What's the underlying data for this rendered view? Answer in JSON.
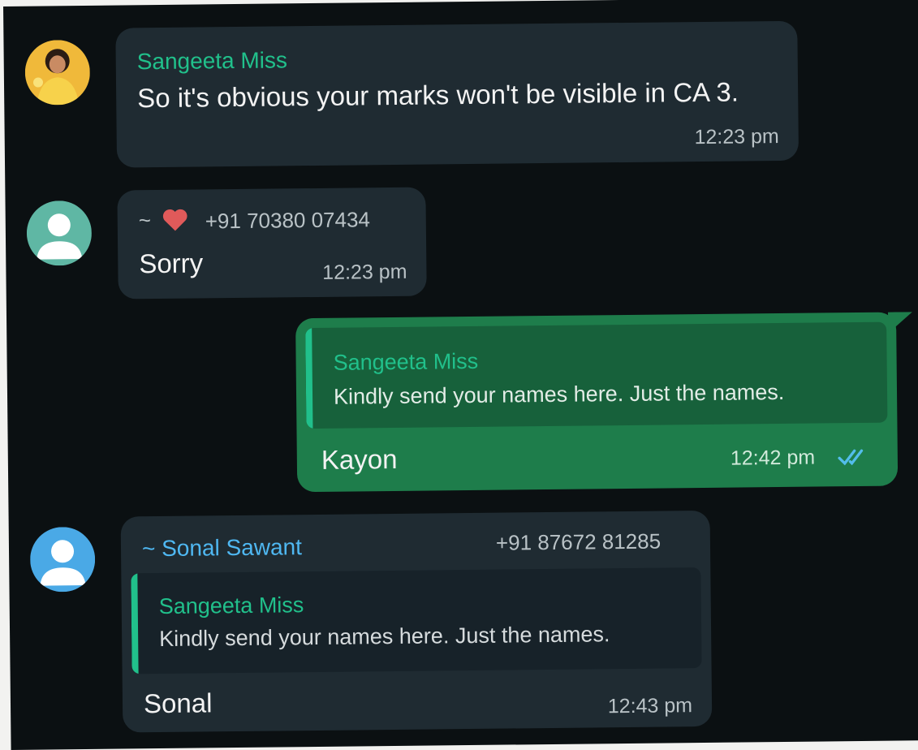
{
  "messages": [
    {
      "sender": "Sangeeta Miss",
      "text": "So it's obvious your marks won't be visible in CA 3.",
      "time": "12:23 pm"
    },
    {
      "sender_prefix": "~",
      "sender_icon": "heart-icon",
      "sender_phone": "+91 70380 07434",
      "text": "Sorry",
      "time": "12:23 pm"
    },
    {
      "quoted_sender": "Sangeeta Miss",
      "quoted_text": "Kindly send your names here. Just the names.",
      "text": "Kayon",
      "time": "12:42 pm",
      "status_icon": "double-check-read-icon"
    },
    {
      "sender": "~ Sonal Sawant",
      "sender_phone": "+91 87672 81285",
      "quoted_sender": "Sangeeta Miss",
      "quoted_text": "Kindly send your names here. Just the names.",
      "text": "Sonal",
      "time": "12:43 pm"
    }
  ],
  "colors": {
    "background": "#0b1012",
    "incoming_bubble": "#1f2b32",
    "outgoing_bubble": "#1e7d4b",
    "sender_green": "#21c08b",
    "sender_blue": "#4fb8f2",
    "read_ticks": "#53bdeb",
    "heart": "#e05a5a"
  }
}
